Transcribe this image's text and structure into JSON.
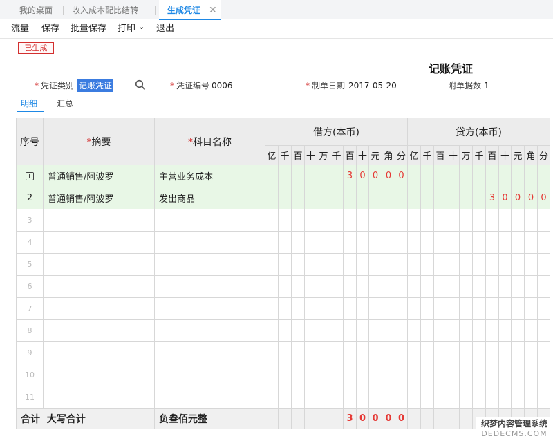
{
  "tabs": [
    {
      "label": "我的桌面"
    },
    {
      "label": "收入成本配比结转"
    },
    {
      "label": "生成凭证",
      "close": "✕"
    }
  ],
  "toolbar": {
    "flow": "流量",
    "save": "保存",
    "batch_save": "批量保存",
    "print": "打印",
    "print_caret": "⌄",
    "exit": "退出"
  },
  "status_badge": "已生成",
  "voucher_title": "记账凭证",
  "fields": {
    "type_label": "凭证类别",
    "type_value": "记账凭证",
    "number_label": "凭证编号",
    "number_value": "0006",
    "date_label": "制单日期",
    "date_value": "2017-05-20",
    "attach_label": "附单据数",
    "attach_value": "1",
    "required_mark": "*"
  },
  "subtabs": {
    "detail": "明细",
    "summary": "汇总"
  },
  "table": {
    "headers": {
      "seq": "序号",
      "summary": "摘要",
      "account": "科目名称",
      "debit": "借方(本币)",
      "credit": "贷方(本币)",
      "digits": [
        "亿",
        "千",
        "百",
        "十",
        "万",
        "千",
        "百",
        "十",
        "元",
        "角",
        "分"
      ]
    },
    "rows": [
      {
        "seq": "",
        "summary": "普通销售/阿波罗",
        "account": "主营业务成本",
        "debit": [
          "",
          "",
          "",
          "",
          "",
          "",
          "3",
          "0",
          "0",
          "0",
          "0"
        ],
        "credit": [
          "",
          "",
          "",
          "",
          "",
          "",
          "",
          "",
          "",
          "",
          ""
        ]
      },
      {
        "seq": "2",
        "summary": "普通销售/阿波罗",
        "account": "发出商品",
        "debit": [
          "",
          "",
          "",
          "",
          "",
          "",
          "",
          "",
          "",
          "",
          ""
        ],
        "credit": [
          "",
          "",
          "",
          "",
          "",
          "",
          "3",
          "0",
          "0",
          "0",
          "0"
        ]
      }
    ],
    "empty_rows": [
      "3",
      "4",
      "5",
      "6",
      "7",
      "8",
      "9",
      "10",
      "11"
    ],
    "footer": {
      "label": "合计  大写合计",
      "amount_words": "负叁佰元整",
      "debit": [
        "",
        "",
        "",
        "",
        "",
        "",
        "3",
        "0",
        "0",
        "0",
        "0"
      ],
      "credit": [
        "",
        "",
        "",
        "",
        "",
        "",
        "",
        "",
        "",
        "",
        ""
      ]
    }
  },
  "watermark": {
    "line1": "织梦内容管理系统",
    "line2": "DEDECMS.COM"
  }
}
